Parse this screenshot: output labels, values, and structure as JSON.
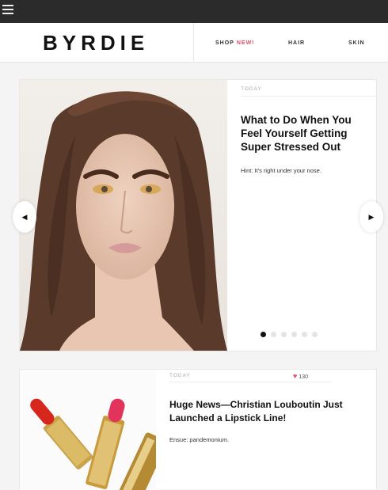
{
  "brand": {
    "logo": "BYRDIE"
  },
  "nav": {
    "items": [
      {
        "label": "SHOP",
        "badge": "NEW!"
      },
      {
        "label": "HAIR"
      },
      {
        "label": "SKIN"
      }
    ]
  },
  "carousel": {
    "slide": {
      "label": "TODAY",
      "title": "What to Do When You Feel Yourself Getting Super Stressed Out",
      "dek": "Hint: It's right under your nose."
    },
    "total_slides": 6,
    "active_slide": 1,
    "prev_icon": "chevron-left-icon",
    "next_icon": "chevron-right-icon"
  },
  "article2": {
    "label": "TODAY",
    "likes": "130",
    "title": "Huge News—Christian Louboutin Just Launched a Lipstick Line!",
    "dek": "Ensue: pandemonium."
  },
  "colors": {
    "accent": "#e94b6a",
    "topbar": "#2b2b2b"
  }
}
